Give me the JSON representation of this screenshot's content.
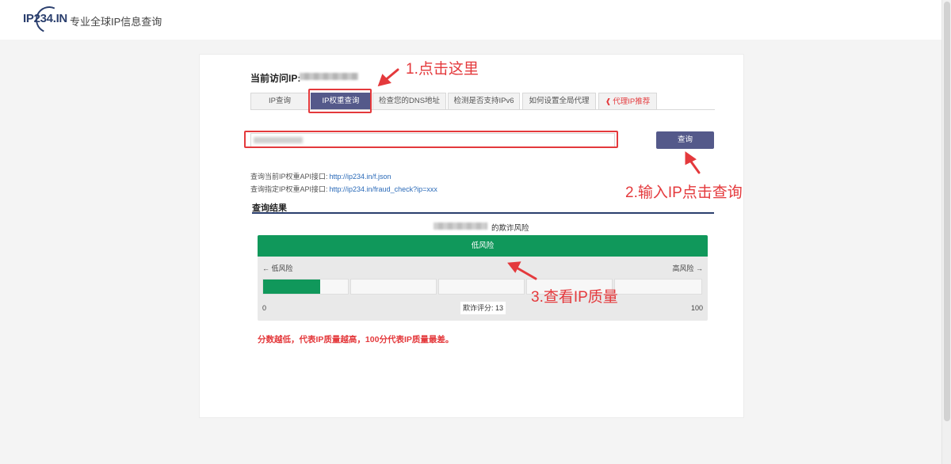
{
  "header": {
    "logo_text": "IP234.IN",
    "slogan": "专业全球IP信息查询"
  },
  "visitor": {
    "label": "当前访问IP:"
  },
  "tabs": [
    {
      "label": "IP查询"
    },
    {
      "label": "IP权重查询",
      "active": true
    },
    {
      "label": "检查您的DNS地址"
    },
    {
      "label": "检测是否支持IPv6"
    },
    {
      "label": "如何设置全局代理"
    },
    {
      "label": "代理IP推荐",
      "icon": "share-icon",
      "color": "#e4393c"
    }
  ],
  "search": {
    "button_label": "查询"
  },
  "api": {
    "current_label": "查询当前IP权重API接口:",
    "current_url": "http://ip234.in/f.json",
    "specific_label": "查询指定IP权重API接口:",
    "specific_url": "http://ip234.in/fraud_check?ip=xxx"
  },
  "result": {
    "title": "查询结果",
    "risk_suffix": "的欺诈风险",
    "risk_level": "低风险",
    "low_label": "← 低风险",
    "high_label": "高风险 →",
    "scale_min": "0",
    "scale_max": "100",
    "score_text": "欺诈评分: 13",
    "score_value": 13,
    "risk_color": "#10985b"
  },
  "note": "分数越低，代表IP质量越高，100分代表IP质量最差。",
  "annotations": {
    "step1": "1.点击这里",
    "step2": "2.输入IP点击查询",
    "step3": "3.查看IP质量",
    "color": "#e4393c"
  }
}
